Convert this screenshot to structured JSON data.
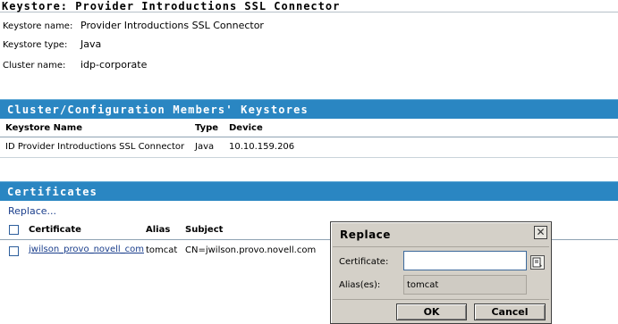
{
  "page": {
    "title": "Keystore: Provider Introductions SSL Connector"
  },
  "keystore": {
    "name_label": "Keystore name:",
    "name_value": "Provider Introductions SSL Connector",
    "type_label": "Keystore type:",
    "type_value": "Java",
    "cluster_label": "Cluster name:",
    "cluster_value": "idp-corporate"
  },
  "members_section": {
    "title": "Cluster/Configuration Members' Keystores",
    "columns": [
      "Keystore Name",
      "Type",
      "Device"
    ],
    "rows": [
      [
        "ID Provider Introductions SSL Connector",
        "Java",
        "10.10.159.206"
      ]
    ]
  },
  "certificates_section": {
    "title": "Certificates",
    "replace_link": "Replace...",
    "columns": [
      "Certificate",
      "Alias",
      "Subject"
    ],
    "rows": [
      [
        "jwilson_provo_novell_com",
        "tomcat",
        "CN=jwilson.provo.novell.com"
      ]
    ]
  },
  "replace_dialog": {
    "title": "Replace",
    "close_glyph": "✕",
    "certificate_label": "Certificate:",
    "certificate_value": "",
    "alias_label": "Alias(es):",
    "alias_value": "tomcat",
    "ok_label": "OK",
    "cancel_label": "Cancel"
  }
}
